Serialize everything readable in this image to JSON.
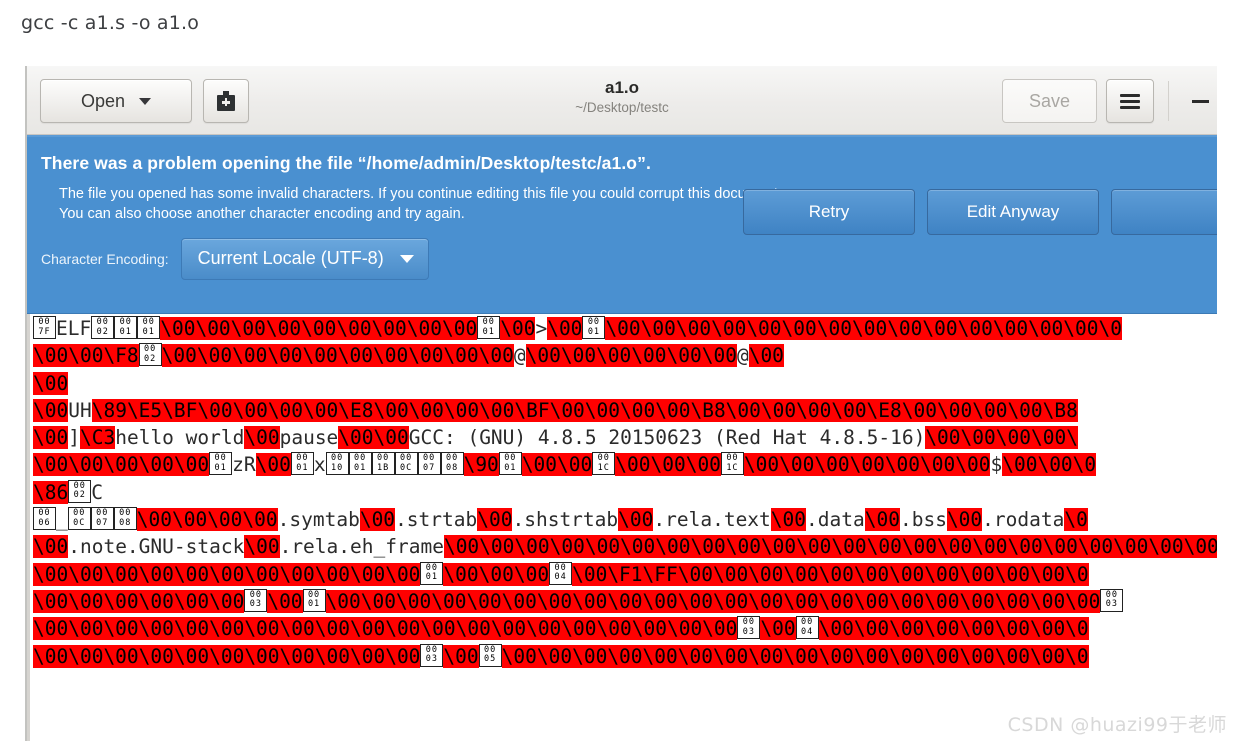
{
  "terminal": {
    "command": "gcc -c a1.s -o a1.o"
  },
  "window": {
    "headerbar": {
      "open_label": "Open",
      "new_doc_icon": "new-document-icon",
      "title": "a1.o",
      "subtitle": "~/Desktop/testc",
      "save_label": "Save",
      "menu_icon": "hamburger-menu-icon",
      "minimize_icon": "minimize-icon"
    },
    "infobar": {
      "heading": "There was a problem opening the file “/home/admin/Desktop/testc/a1.o”.",
      "body_line1": "The file you opened has some invalid characters. If you continue editing this file you could corrupt this document.",
      "body_line2": "You can also choose another character encoding and try again.",
      "encoding_label": "Character Encoding:",
      "encoding_value": "Current Locale (UTF-8)",
      "buttons": [
        "Retry",
        "Edit Anyway",
        ""
      ]
    }
  },
  "hexview": {
    "lines": [
      [
        {
          "t": "ctl",
          "hi": "00",
          "lo": "7F"
        },
        {
          "t": "pl",
          "v": "ELF"
        },
        {
          "t": "ctl",
          "hi": "00",
          "lo": "02"
        },
        {
          "t": "ctl",
          "hi": "00",
          "lo": "01"
        },
        {
          "t": "ctl",
          "hi": "00",
          "lo": "01"
        },
        {
          "t": "inv",
          "v": "\\00\\00\\00\\00\\00\\00\\00\\00\\00"
        },
        {
          "t": "ctl",
          "hi": "00",
          "lo": "01"
        },
        {
          "t": "inv",
          "v": "\\00"
        },
        {
          "t": "pl",
          "v": ">"
        },
        {
          "t": "inv",
          "v": "\\00"
        },
        {
          "t": "ctl",
          "hi": "00",
          "lo": "01"
        },
        {
          "t": "inv",
          "v": "\\00\\00\\00\\00\\00\\00\\00\\00\\00\\00\\00\\00\\00\\00\\0"
        }
      ],
      [
        {
          "t": "inv",
          "v": "\\00\\00\\F8"
        },
        {
          "t": "ctl",
          "hi": "00",
          "lo": "02"
        },
        {
          "t": "inv",
          "v": "\\00\\00\\00\\00\\00\\00\\00\\00\\00\\00"
        },
        {
          "t": "pl",
          "v": "@"
        },
        {
          "t": "inv",
          "v": "\\00\\00\\00\\00\\00\\00"
        },
        {
          "t": "pl",
          "v": "@"
        },
        {
          "t": "inv",
          "v": "\\00"
        }
      ],
      [
        {
          "t": "inv",
          "v": "\\00"
        }
      ],
      [
        {
          "t": "inv",
          "v": "\\00"
        },
        {
          "t": "pl",
          "v": "UH"
        },
        {
          "t": "inv",
          "v": "\\89\\E5\\BF\\00\\00\\00\\00\\E8\\00\\00\\00\\00\\BF\\00\\00\\00\\00\\B8\\00\\00\\00\\00\\E8\\00\\00\\00\\00\\B8"
        }
      ],
      [
        {
          "t": "inv",
          "v": "\\00"
        },
        {
          "t": "pl",
          "v": "]"
        },
        {
          "t": "inv",
          "v": "\\C3"
        },
        {
          "t": "pl",
          "v": "hello world"
        },
        {
          "t": "inv",
          "v": "\\00"
        },
        {
          "t": "pl",
          "v": "pause"
        },
        {
          "t": "inv",
          "v": "\\00\\00"
        },
        {
          "t": "pl",
          "v": "GCC: (GNU) 4.8.5 20150623 (Red Hat 4.8.5-16)"
        },
        {
          "t": "inv",
          "v": "\\00\\00\\00\\00\\"
        }
      ],
      [
        {
          "t": "inv",
          "v": "\\00\\00\\00\\00\\00"
        },
        {
          "t": "ctl",
          "hi": "00",
          "lo": "01"
        },
        {
          "t": "pl",
          "v": "zR"
        },
        {
          "t": "inv",
          "v": "\\00"
        },
        {
          "t": "ctl",
          "hi": "00",
          "lo": "01"
        },
        {
          "t": "pl",
          "v": "x"
        },
        {
          "t": "ctl",
          "hi": "00",
          "lo": "10"
        },
        {
          "t": "ctl",
          "hi": "00",
          "lo": "01"
        },
        {
          "t": "ctl",
          "hi": "00",
          "lo": "1B"
        },
        {
          "t": "ctl",
          "hi": "00",
          "lo": "0C"
        },
        {
          "t": "ctl",
          "hi": "00",
          "lo": "07"
        },
        {
          "t": "ctl",
          "hi": "00",
          "lo": "08"
        },
        {
          "t": "inv",
          "v": "\\90"
        },
        {
          "t": "ctl",
          "hi": "00",
          "lo": "01"
        },
        {
          "t": "inv",
          "v": "\\00\\00"
        },
        {
          "t": "ctl",
          "hi": "00",
          "lo": "1C"
        },
        {
          "t": "inv",
          "v": "\\00\\00\\00"
        },
        {
          "t": "ctl",
          "hi": "00",
          "lo": "1C"
        },
        {
          "t": "inv",
          "v": "\\00\\00\\00\\00\\00\\00\\00"
        },
        {
          "t": "pl",
          "v": "$"
        },
        {
          "t": "inv",
          "v": "\\00\\00\\0"
        }
      ],
      [
        {
          "t": "inv",
          "v": "\\86"
        },
        {
          "t": "ctl",
          "hi": "00",
          "lo": "02"
        },
        {
          "t": "pl",
          "v": "C"
        }
      ],
      [
        {
          "t": "ctl",
          "hi": "00",
          "lo": "06"
        },
        {
          "t": "pl",
          "v": "_"
        },
        {
          "t": "ctl",
          "hi": "00",
          "lo": "0C"
        },
        {
          "t": "ctl",
          "hi": "00",
          "lo": "07"
        },
        {
          "t": "ctl",
          "hi": "00",
          "lo": "08"
        },
        {
          "t": "inv",
          "v": "\\00\\00\\00\\00"
        },
        {
          "t": "pl",
          "v": ".symtab"
        },
        {
          "t": "inv",
          "v": "\\00"
        },
        {
          "t": "pl",
          "v": ".strtab"
        },
        {
          "t": "inv",
          "v": "\\00"
        },
        {
          "t": "pl",
          "v": ".shstrtab"
        },
        {
          "t": "inv",
          "v": "\\00"
        },
        {
          "t": "pl",
          "v": ".rela.text"
        },
        {
          "t": "inv",
          "v": "\\00"
        },
        {
          "t": "pl",
          "v": ".data"
        },
        {
          "t": "inv",
          "v": "\\00"
        },
        {
          "t": "pl",
          "v": ".bss"
        },
        {
          "t": "inv",
          "v": "\\00"
        },
        {
          "t": "pl",
          "v": ".rodata"
        },
        {
          "t": "inv",
          "v": "\\0"
        }
      ],
      [
        {
          "t": "inv",
          "v": "\\00"
        },
        {
          "t": "pl",
          "v": ".note.GNU-stack"
        },
        {
          "t": "inv",
          "v": "\\00"
        },
        {
          "t": "pl",
          "v": ".rela.eh_frame"
        },
        {
          "t": "inv",
          "v": "\\00\\00\\00\\00\\00\\00\\00\\00\\00\\00\\00\\00\\00\\00\\00\\00\\00\\00\\00\\00\\00\\00\\00\\00"
        }
      ],
      [
        {
          "t": "inv",
          "v": "\\00\\00\\00\\00\\00\\00\\00\\00\\00\\00\\00"
        },
        {
          "t": "ctl",
          "hi": "00",
          "lo": "01"
        },
        {
          "t": "inv",
          "v": "\\00\\00\\00"
        },
        {
          "t": "ctl",
          "hi": "00",
          "lo": "04"
        },
        {
          "t": "inv",
          "v": "\\00\\F1\\FF\\00\\00\\00\\00\\00\\00\\00\\00\\00\\00\\00\\0"
        }
      ],
      [
        {
          "t": "inv",
          "v": "\\00\\00\\00\\00\\00\\00"
        },
        {
          "t": "ctl",
          "hi": "00",
          "lo": "03"
        },
        {
          "t": "inv",
          "v": "\\00"
        },
        {
          "t": "ctl",
          "hi": "00",
          "lo": "01"
        },
        {
          "t": "inv",
          "v": "\\00\\00\\00\\00\\00\\00\\00\\00\\00\\00\\00\\00\\00\\00\\00\\00\\00\\00\\00\\00\\00\\00"
        },
        {
          "t": "ctl",
          "hi": "00",
          "lo": "03"
        }
      ],
      [
        {
          "t": "inv",
          "v": "\\00\\00\\00\\00\\00\\00\\00\\00\\00\\00\\00\\00\\00\\00\\00\\00\\00\\00\\00\\00"
        },
        {
          "t": "ctl",
          "hi": "00",
          "lo": "03"
        },
        {
          "t": "inv",
          "v": "\\00"
        },
        {
          "t": "ctl",
          "hi": "00",
          "lo": "04"
        },
        {
          "t": "inv",
          "v": "\\00\\00\\00\\00\\00\\00\\00\\0"
        }
      ],
      [
        {
          "t": "inv",
          "v": "\\00\\00\\00\\00\\00\\00\\00\\00\\00\\00\\00"
        },
        {
          "t": "ctl",
          "hi": "00",
          "lo": "03"
        },
        {
          "t": "inv",
          "v": "\\00"
        },
        {
          "t": "ctl",
          "hi": "00",
          "lo": "05"
        },
        {
          "t": "inv",
          "v": "\\00\\00\\00\\00\\00\\00\\00\\00\\00\\00\\00\\00\\00\\00\\00\\00\\0"
        }
      ]
    ]
  },
  "watermark": {
    "text": "CSDN @huazi99于老师"
  },
  "colors": {
    "infobar_bg": "#4a90d0",
    "invalid_char_bg": "#ff0000",
    "headerbar_bg": "#edecea"
  }
}
